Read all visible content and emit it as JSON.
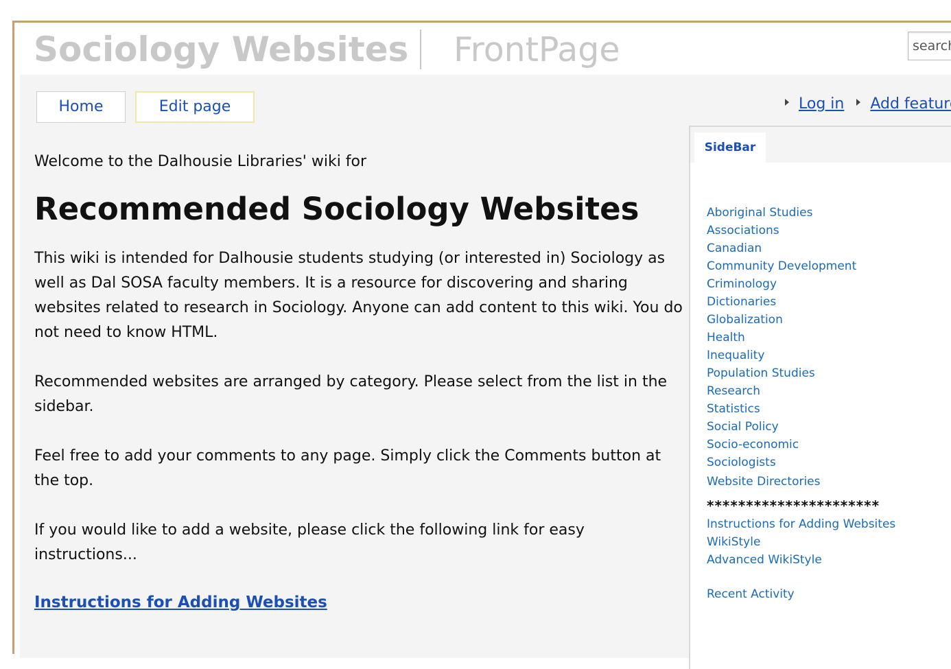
{
  "header": {
    "site_title": "Sociology Websites",
    "page_name": "FrontPage",
    "search_value": "search"
  },
  "nav": {
    "home_label": "Home",
    "edit_label": "Edit page",
    "login_label": "Log in",
    "add_feature_label": "Add feature"
  },
  "main": {
    "welcome": "Welcome to the Dalhousie Libraries' wiki for",
    "heading": "Recommended Sociology Websites",
    "paragraph1": "This wiki is intended for Dalhousie students studying (or interested in) Sociology as well as Dal SOSA faculty members. It is a resource for discovering and sharing websites related to research in Sociology. Anyone can add content to this wiki. You do not need to know HTML.",
    "paragraph2": "Recommended websites are arranged by category. Please select from the list in the sidebar.",
    "paragraph3": "Feel free to add your comments to any page. Simply click the Comments button at the top.",
    "paragraph4": "If you would like to add a website, please click the following link for easy instructions...",
    "instructions_link": "Instructions for Adding Websites"
  },
  "sidebar": {
    "tab_label": "SideBar",
    "categories": [
      "Aboriginal Studies",
      "Associations",
      "Canadian",
      "Community Development",
      "Criminology",
      "Dictionaries",
      "Globalization",
      "Health",
      "Inequality",
      "Population Studies",
      "Research",
      "Statistics",
      "Social Policy",
      "Socio-economic",
      "Sociologists",
      "Website Directories"
    ],
    "separator": "**********************",
    "help_links": [
      "Instructions for Adding Websites",
      "WikiStyle",
      "Advanced WikiStyle"
    ],
    "recent_activity": "Recent Activity"
  }
}
